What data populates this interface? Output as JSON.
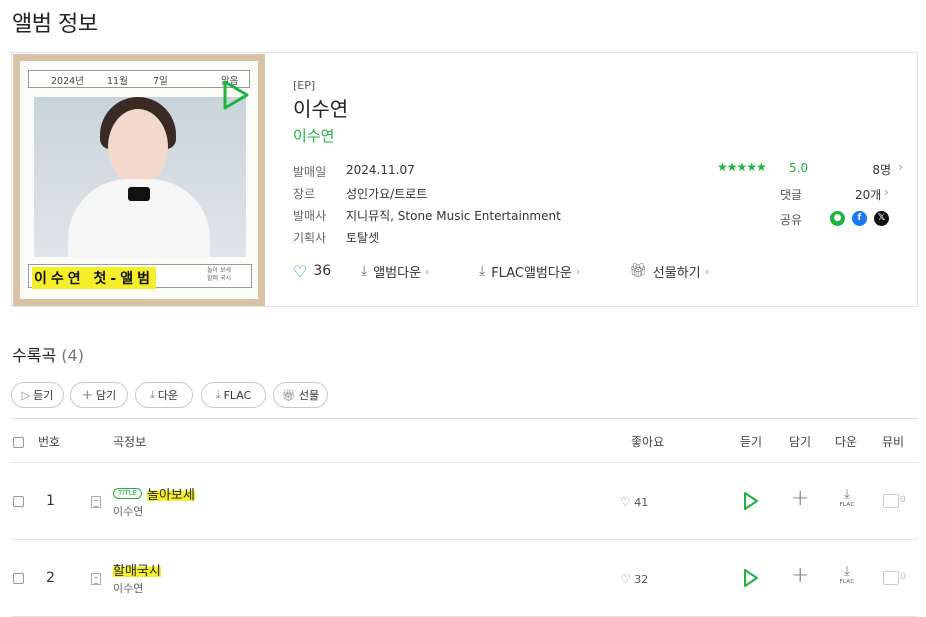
{
  "page": {
    "title": "앨범 정보"
  },
  "cover": {
    "date_year": "2024년",
    "date_month": "11월",
    "date_day": "7일",
    "weather": "맑음",
    "title_text": "이수연 첫-앨범",
    "sub_text": "놀아 보세\n할매 국시"
  },
  "album": {
    "type": "[EP]",
    "title": "이수연",
    "artist": "이수연",
    "meta": [
      {
        "label": "발매일",
        "value": "2024.11.07"
      },
      {
        "label": "장르",
        "value": "성인가요/트로트"
      },
      {
        "label": "발매사",
        "value": "지니뮤직, Stone Music Entertainment"
      },
      {
        "label": "기획사",
        "value": "토탈셋"
      }
    ],
    "rating": {
      "stars": "★★★★★",
      "score": "5.0",
      "count": "8명"
    },
    "comments": {
      "label": "댓글",
      "count": "20개"
    },
    "share": {
      "label": "공유"
    },
    "likes": "36",
    "actions": {
      "download": "앨범다운",
      "flac_download": "FLAC앨범다운",
      "gift": "선물하기"
    }
  },
  "tracks_section": {
    "title": "수록곡",
    "count": "(4)",
    "buttons": {
      "listen": "듣기",
      "add": "담기",
      "download": "다운",
      "flac": "FLAC",
      "gift": "선물"
    },
    "headers": {
      "number": "번호",
      "info": "곡정보",
      "likes": "좋아요",
      "listen": "듣기",
      "add": "담기",
      "download": "다운",
      "mv": "뮤비"
    },
    "title_badge": "TITLE",
    "flac_label": "FLAC",
    "rows": [
      {
        "num": "1",
        "title": "놀아보세",
        "artist": "이수연",
        "likes": "41",
        "mv": "0",
        "is_title": true
      },
      {
        "num": "2",
        "title": "할매국시",
        "artist": "이수연",
        "likes": "32",
        "mv": "0",
        "is_title": false
      }
    ]
  },
  "colors": {
    "accent": "#1db440",
    "highlight": "#f5ef2a"
  },
  "icons": [
    "play-icon",
    "heart-icon",
    "download-icon",
    "gift-icon",
    "plus-icon",
    "chevron-right-icon",
    "document-icon",
    "share-melon-icon",
    "share-facebook-icon",
    "share-x-icon"
  ]
}
